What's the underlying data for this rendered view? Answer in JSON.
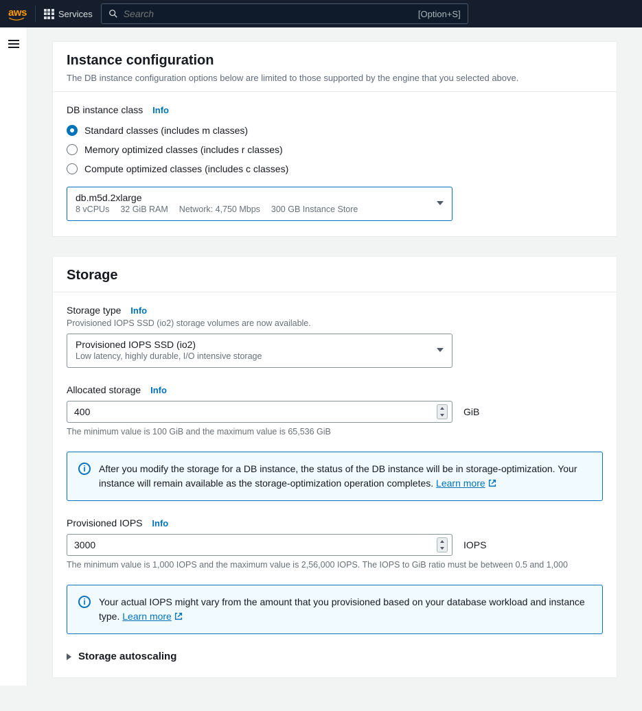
{
  "topnav": {
    "logo_text": "aws",
    "services_label": "Services",
    "search_placeholder": "Search",
    "search_hint": "[Option+S]"
  },
  "instance_config": {
    "title": "Instance configuration",
    "subtitle": "The DB instance configuration options below are limited to those supported by the engine that you selected above.",
    "class_label": "DB instance class",
    "info": "Info",
    "options": {
      "standard": "Standard classes (includes m classes)",
      "memory": "Memory optimized classes (includes r classes)",
      "compute": "Compute optimized classes (includes c classes)"
    },
    "selected_instance": {
      "name": "db.m5d.2xlarge",
      "vcpu": "8 vCPUs",
      "ram": "32 GiB RAM",
      "network": "Network: 4,750 Mbps",
      "store": "300 GB Instance Store"
    }
  },
  "storage": {
    "title": "Storage",
    "type_label": "Storage type",
    "info": "Info",
    "type_helper": "Provisioned IOPS SSD (io2) storage volumes are now available.",
    "type_select": {
      "main": "Provisioned IOPS SSD (io2)",
      "sub": "Low latency, highly durable, I/O intensive storage"
    },
    "allocated_label": "Allocated storage",
    "allocated_value": "400",
    "allocated_unit": "GiB",
    "allocated_helper": "The minimum value is 100 GiB and the maximum value is 65,536 GiB",
    "alert1_text": "After you modify the storage for a DB instance, the status of the DB instance will be in storage-optimization. Your instance will remain available as the storage-optimization operation completes. ",
    "learn_more": "Learn more",
    "iops_label": "Provisioned IOPS",
    "iops_value": "3000",
    "iops_unit": "IOPS",
    "iops_helper": "The minimum value is 1,000 IOPS and the maximum value is 2,56,000 IOPS. The IOPS to GiB ratio must be between 0.5 and 1,000",
    "alert2_text": "Your actual IOPS might vary from the amount that you provisioned based on your database workload and instance type. ",
    "autoscaling_label": "Storage autoscaling"
  }
}
